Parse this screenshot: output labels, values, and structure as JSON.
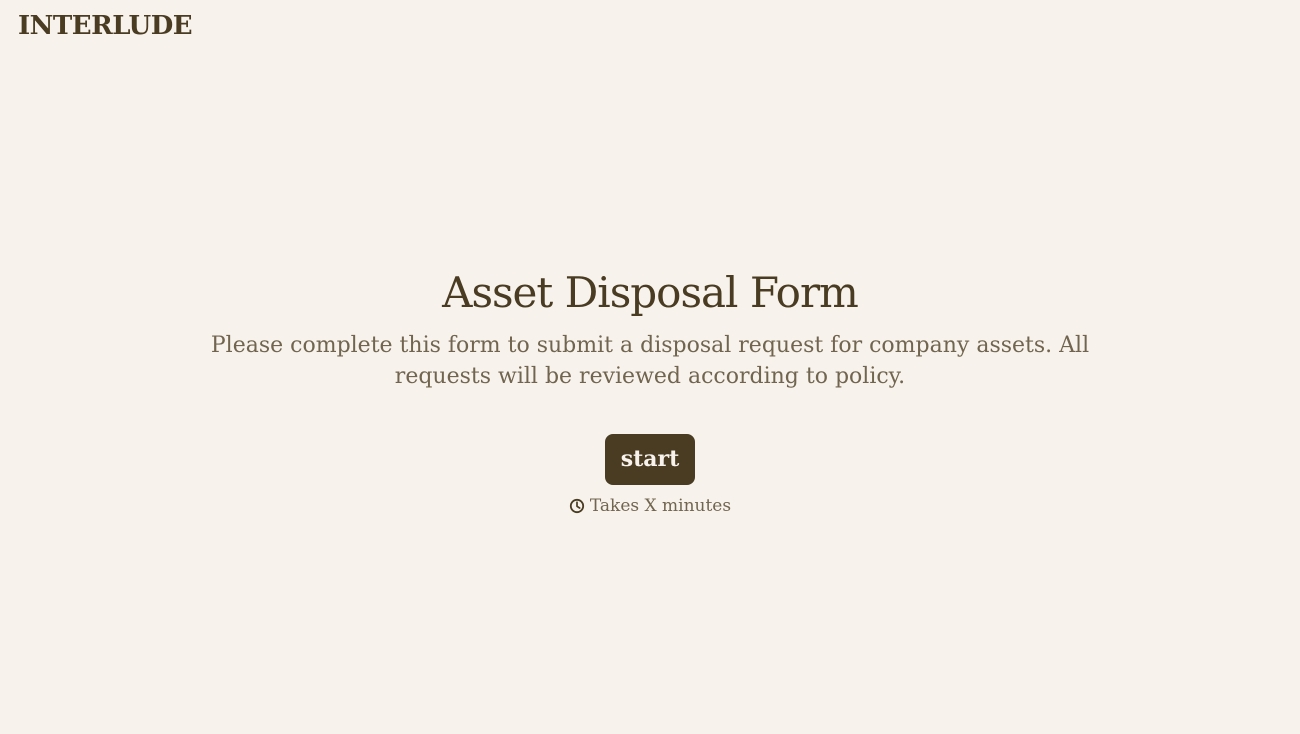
{
  "header": {
    "brand": "INTERLUDE"
  },
  "main": {
    "title": "Asset Disposal Form",
    "description": "Please complete this form to submit a disposal request for company assets. All requests will be reviewed according to policy.",
    "start_button_label": "start",
    "duration_icon": "clock-icon",
    "duration_text": "Takes X minutes"
  },
  "colors": {
    "background": "#f7f2ec",
    "primary": "#4a3c22",
    "muted_text": "#71654f",
    "button_text": "#f7f2ec"
  }
}
